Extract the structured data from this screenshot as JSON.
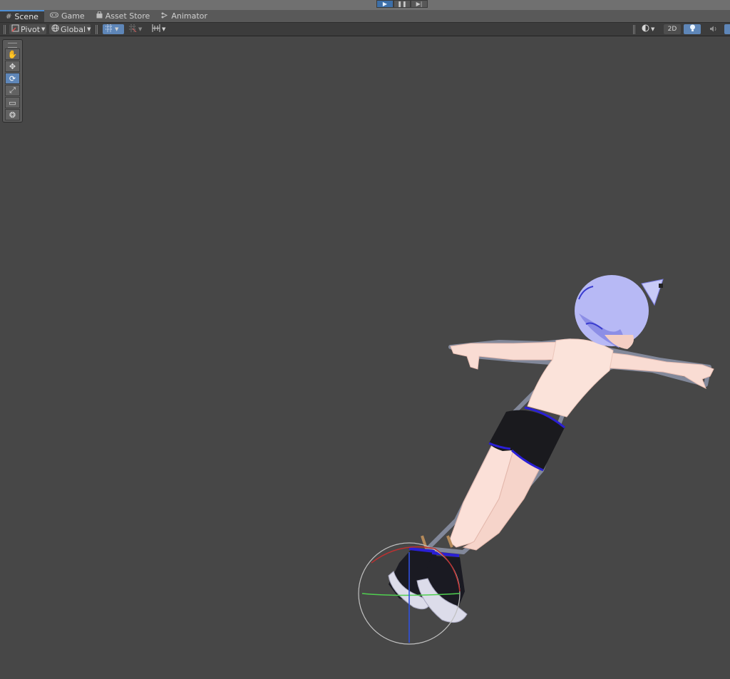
{
  "playbar": {
    "buttons": [
      {
        "name": "play-button",
        "glyph": "▶",
        "active": true
      },
      {
        "name": "pause-button",
        "glyph": "❚❚",
        "active": false
      },
      {
        "name": "step-button",
        "glyph": "▶|",
        "active": false
      }
    ]
  },
  "tabs": [
    {
      "label": "Scene",
      "icon": "#",
      "active": true
    },
    {
      "label": "Game",
      "icon": "👓",
      "active": false
    },
    {
      "label": "Asset Store",
      "icon": "🔒",
      "active": false
    },
    {
      "label": "Animator",
      "icon": "⤳",
      "active": false
    }
  ],
  "toolbar": {
    "pivot_label": "Pivot",
    "global_label": "Global",
    "mode_2d_label": "2D"
  },
  "tools": [
    {
      "name": "hand-tool",
      "glyph": "✋",
      "active": false
    },
    {
      "name": "move-tool",
      "glyph": "✥",
      "active": false
    },
    {
      "name": "rotate-tool",
      "glyph": "⟳",
      "active": true
    },
    {
      "name": "scale-tool",
      "glyph": "⤢",
      "active": false
    },
    {
      "name": "rect-tool",
      "glyph": "▭",
      "active": false
    },
    {
      "name": "transform-tool",
      "glyph": "❂",
      "active": false
    }
  ],
  "colors": {
    "viewport": "#474747",
    "accent": "#5e86b8",
    "hair": "#b7b9f5",
    "skin": "#fbe0d8",
    "shorts": "#1a1a1e",
    "trim": "#2a1fd6",
    "shoe": "#d9d9e8"
  }
}
